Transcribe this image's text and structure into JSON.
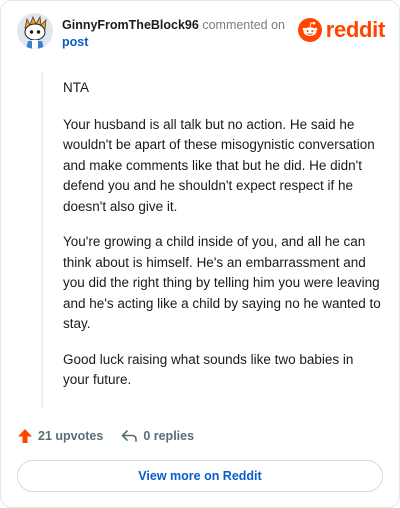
{
  "header": {
    "username": "GinnyFromTheBlock96",
    "action_text": "commented on",
    "post_link": "post",
    "brand": "reddit"
  },
  "comment": {
    "paragraphs": [
      "NTA",
      "Your husband is all talk but no action. He said he wouldn't be apart of these misogynistic conversation and make comments like that but he did. He didn't defend you and he shouldn't expect respect if he doesn't also give it.",
      "You're growing a child inside of you, and all he can think about is himself. He's an embarrassment and you did the right thing by telling him you were leaving and he's acting like a child by saying no he wanted to stay.",
      "Good luck raising what sounds like two babies in your future."
    ]
  },
  "footer": {
    "upvotes": "21 upvotes",
    "replies": "0 replies",
    "view_more": "View more on Reddit"
  },
  "colors": {
    "brand": "#ff4500",
    "link": "#0a5cc9"
  },
  "icons": {
    "upvote": "upvote-arrow-icon",
    "reply": "reply-arrow-icon",
    "brand": "reddit-snoo-icon"
  }
}
